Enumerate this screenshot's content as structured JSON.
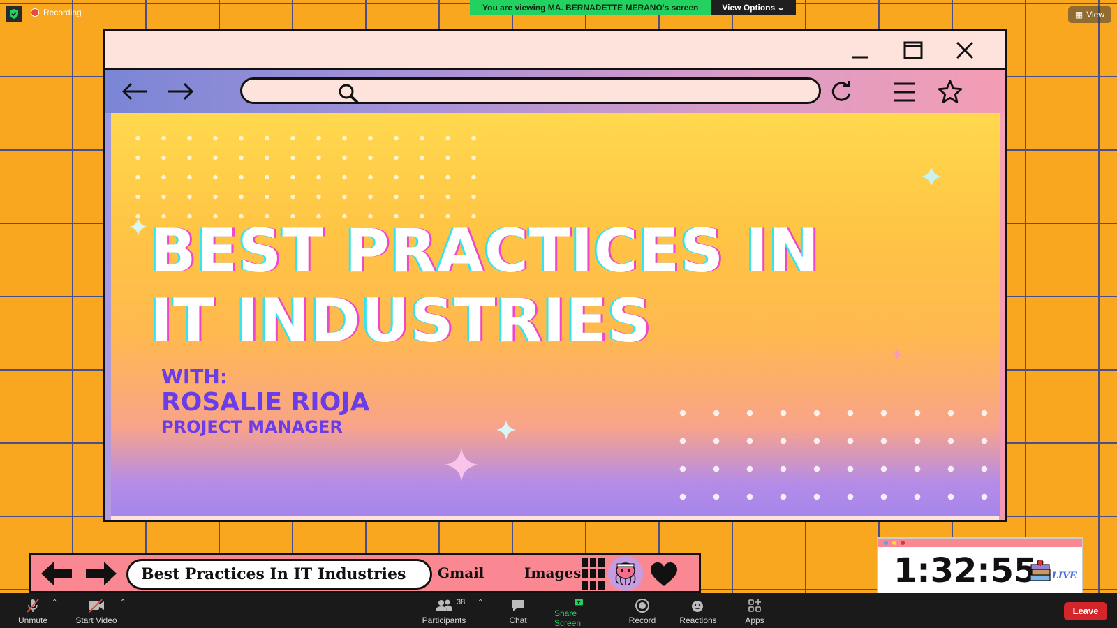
{
  "zoom_top": {
    "recording_label": "Recording",
    "viewing_banner": "You are viewing MA. BERNADETTE MERANO's screen",
    "view_options_label": "View Options",
    "view_button_label": "View"
  },
  "slide": {
    "headline_line1": "BEST PRACTICES IN",
    "headline_line2": "IT INDUSTRIES",
    "with_label": "WITH:",
    "speaker_name": "ROSALIE RIOJA",
    "speaker_role": "PROJECT MANAGER"
  },
  "slide_bar": {
    "title": "Best Practices In IT Industries",
    "link_gmail": "Gmail",
    "link_images": "Images"
  },
  "timer": {
    "time": "1:32:55",
    "live_label": "LIVE"
  },
  "zoom_toolbar": {
    "unmute": "Unmute",
    "start_video": "Start Video",
    "participants": "Participants",
    "participants_count": "38",
    "chat": "Chat",
    "share_screen": "Share Screen",
    "record": "Record",
    "reactions": "Reactions",
    "apps": "Apps",
    "leave": "Leave"
  },
  "colors": {
    "background": "#f8a71e",
    "grid_lines": "#4a4e8a",
    "share_green": "#23d160",
    "leave_red": "#d3252a",
    "headline_text": "#ffffff",
    "speaker_text": "#6a3de8",
    "bar_pink": "#f98893"
  }
}
